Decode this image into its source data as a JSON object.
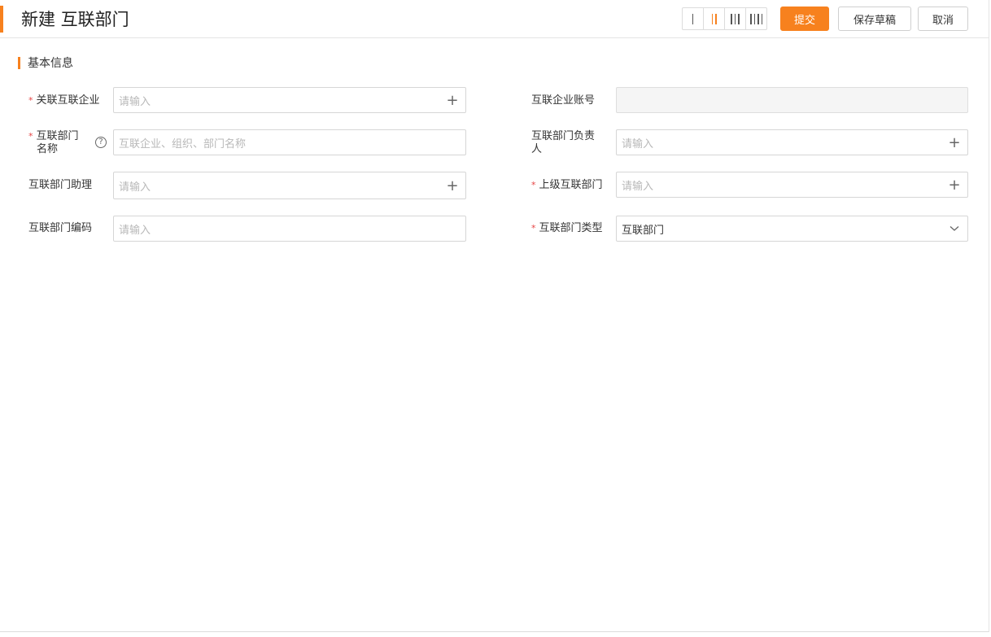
{
  "header": {
    "title": "新建 互联部门",
    "submit_label": "提交",
    "save_draft_label": "保存草稿",
    "cancel_label": "取消",
    "layout_options": [
      "I",
      "II",
      "III",
      "IIII"
    ],
    "layout_selected": "II",
    "accent_color": "#f7811e"
  },
  "section": {
    "title": "基本信息"
  },
  "fields": {
    "linked_company": {
      "label": "关联互联企业",
      "required": true,
      "placeholder": "请输入",
      "action_icon": "plus-icon"
    },
    "company_account": {
      "label": "互联企业账号",
      "required": false,
      "value": "",
      "disabled": true
    },
    "dept_name": {
      "label_line1": "互联部门",
      "label_line2": "名称",
      "required": true,
      "placeholder": "互联企业、组织、部门名称",
      "help_icon": "question-circle-icon"
    },
    "dept_leader": {
      "label_line1": "互联部门负责",
      "label_line2": "人",
      "required": false,
      "placeholder": "请输入",
      "action_icon": "plus-icon"
    },
    "dept_assistant": {
      "label": "互联部门助理",
      "required": false,
      "placeholder": "请输入",
      "action_icon": "plus-icon"
    },
    "parent_dept": {
      "label": "上级互联部门",
      "required": true,
      "placeholder": "请输入",
      "action_icon": "plus-icon"
    },
    "dept_code": {
      "label": "互联部门编码",
      "required": false,
      "placeholder": "请输入"
    },
    "dept_type": {
      "label": "互联部门类型",
      "required": true,
      "value": "互联部门",
      "action_icon": "chevron-down-icon"
    }
  },
  "required_mark": "*",
  "help_glyph": "?",
  "plus_glyph": "+"
}
